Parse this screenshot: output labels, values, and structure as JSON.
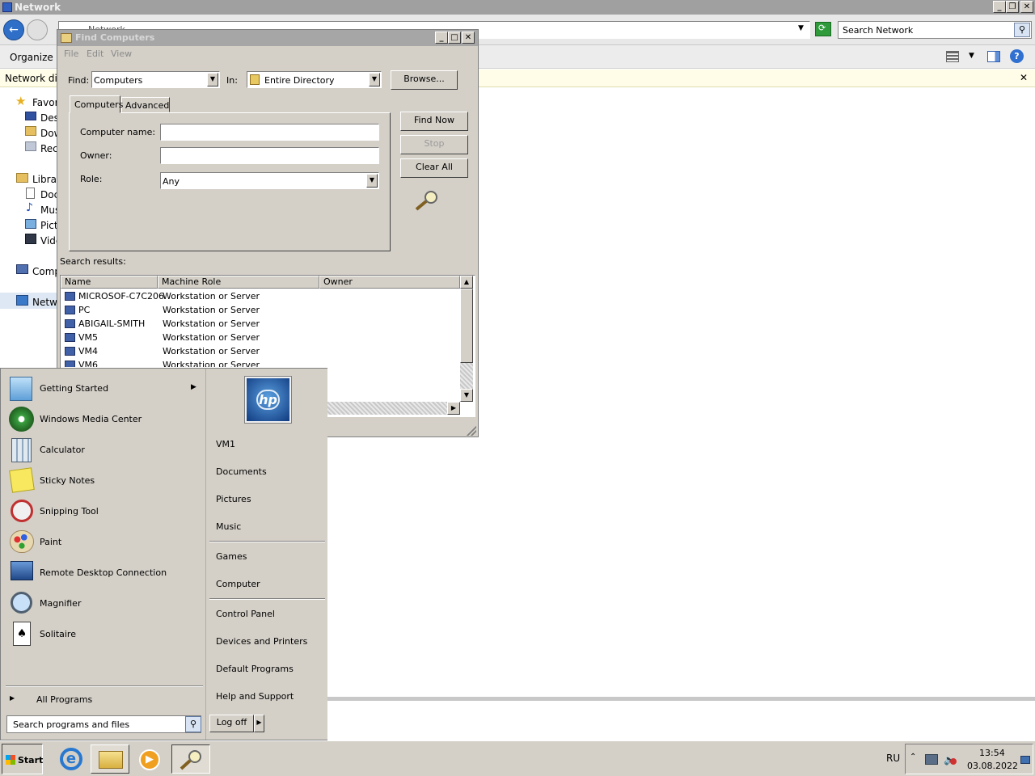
{
  "explorer": {
    "title": "Network",
    "address": "Network",
    "search_placeholder": "Search Network",
    "organize": "Organize",
    "infobar_text": "Network disc",
    "nav": {
      "favorites": "Favor",
      "desktop": "Des",
      "downloads": "Dow",
      "recent": "Rec",
      "libraries": "Librari",
      "documents": "Doc",
      "music": "Mus",
      "pictures": "Pict",
      "videos": "Vide",
      "computer": "Compu",
      "network": "Netwo"
    }
  },
  "find_dialog": {
    "title": "Find Computers",
    "menu": [
      "File",
      "Edit",
      "View"
    ],
    "find_label": "Find:",
    "find_value": "Computers",
    "in_label": "In:",
    "in_value": "Entire Directory",
    "browse_button": "Browse...",
    "tabs": [
      "Computers",
      "Advanced"
    ],
    "computer_name_label": "Computer name:",
    "computer_name_value": "",
    "owner_label": "Owner:",
    "owner_value": "",
    "role_label": "Role:",
    "role_value": "Any",
    "find_now_button": "Find Now",
    "stop_button": "Stop",
    "clear_all_button": "Clear All",
    "search_results_label": "Search results:",
    "columns": [
      "Name",
      "Machine Role",
      "Owner"
    ],
    "rows": [
      {
        "name": "MICROSOF-C7C206",
        "role": "Workstation or Server",
        "owner": ""
      },
      {
        "name": "PC",
        "role": "Workstation or Server",
        "owner": ""
      },
      {
        "name": "ABIGAIL-SMITH",
        "role": "Workstation or Server",
        "owner": ""
      },
      {
        "name": "VM5",
        "role": "Workstation or Server",
        "owner": ""
      },
      {
        "name": "VM4",
        "role": "Workstation or Server",
        "owner": ""
      },
      {
        "name": "VM6",
        "role": "Workstation or Server",
        "owner": ""
      }
    ]
  },
  "start_menu": {
    "programs": [
      {
        "label": "Getting Started",
        "icon": "getting-started-icon",
        "submenu": true
      },
      {
        "label": "Windows Media Center",
        "icon": "media-center-icon"
      },
      {
        "label": "Calculator",
        "icon": "calculator-icon"
      },
      {
        "label": "Sticky Notes",
        "icon": "sticky-notes-icon"
      },
      {
        "label": "Snipping Tool",
        "icon": "snipping-tool-icon"
      },
      {
        "label": "Paint",
        "icon": "paint-icon"
      },
      {
        "label": "Remote Desktop Connection",
        "icon": "remote-desktop-icon"
      },
      {
        "label": "Magnifier",
        "icon": "magnifier-icon"
      },
      {
        "label": "Solitaire",
        "icon": "solitaire-icon"
      }
    ],
    "all_programs": "All Programs",
    "search_placeholder": "Search programs and files",
    "right_items": {
      "user": "VM1",
      "documents": "Documents",
      "pictures": "Pictures",
      "music": "Music",
      "games": "Games",
      "computer": "Computer",
      "control_panel": "Control Panel",
      "devices_printers": "Devices and Printers",
      "default_programs": "Default Programs",
      "help_support": "Help and Support"
    },
    "logoff": "Log off",
    "user_tile_text": "hp"
  },
  "taskbar": {
    "start": "Start",
    "language": "RU",
    "time": "13:54",
    "date": "03.08.2022"
  }
}
